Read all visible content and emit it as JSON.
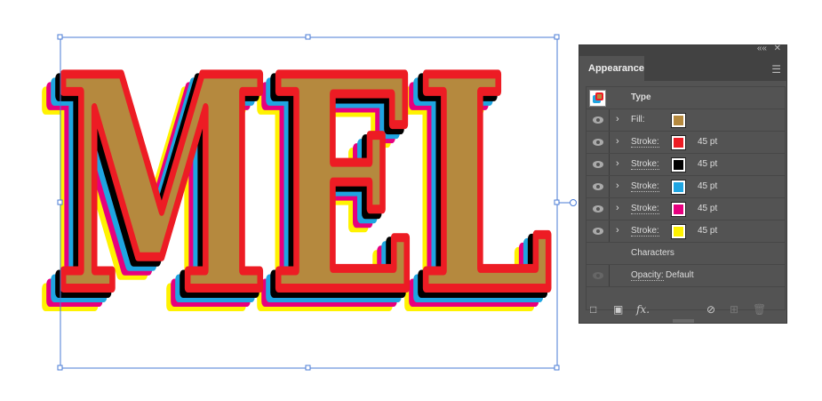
{
  "artwork": {
    "text": "MEL",
    "fill": "#b5893e",
    "stroke_colors": [
      "#ed1c24",
      "#000000",
      "#1fa5e1",
      "#e6007e",
      "#fff200"
    ]
  },
  "panel": {
    "title": "Appearance",
    "collapse_icon": "««",
    "close_icon": "✕",
    "header": "Type",
    "rows": [
      {
        "label": "Fill:",
        "color": "#b5893e",
        "value": ""
      },
      {
        "label": "Stroke:",
        "color": "#ed1c24",
        "value": "45 pt"
      },
      {
        "label": "Stroke:",
        "color": "#000000",
        "value": "45 pt"
      },
      {
        "label": "Stroke:",
        "color": "#1fa5e1",
        "value": "45 pt"
      },
      {
        "label": "Stroke:",
        "color": "#e6007e",
        "value": "45 pt"
      },
      {
        "label": "Stroke:",
        "color": "#fff200",
        "value": "45 pt"
      }
    ],
    "characters": "Characters",
    "opacity_label": "Opacity:",
    "opacity_value": "Default",
    "fx": "fx."
  }
}
